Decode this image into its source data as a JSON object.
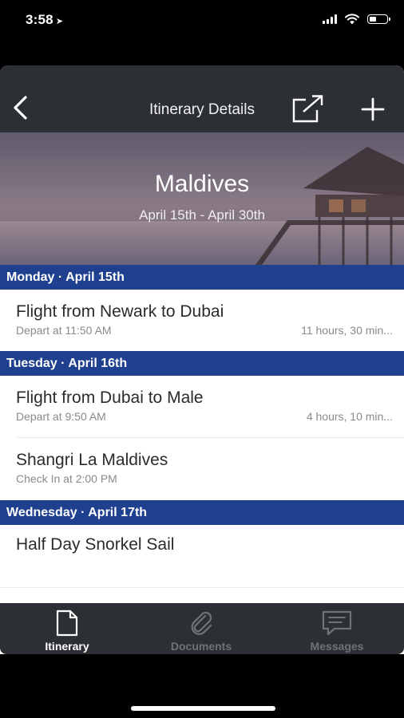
{
  "status": {
    "time": "3:58",
    "location_icon": "location-arrow-icon",
    "signal_icon": "signal-icon",
    "wifi_icon": "wifi-icon",
    "battery_icon": "battery-icon"
  },
  "nav": {
    "title": "Itinerary Details",
    "back_icon": "chevron-left-icon",
    "share_icon": "share-icon",
    "add_icon": "plus-icon"
  },
  "hero": {
    "title": "Maldives",
    "dates": "April 15th - April 30th"
  },
  "days": [
    {
      "header": "Monday · April 15th",
      "items": [
        {
          "title": "Flight from Newark to Dubai",
          "subtitle": "Depart at 11:50 AM",
          "duration": "11 hours, 30 min..."
        }
      ]
    },
    {
      "header": "Tuesday · April 16th",
      "items": [
        {
          "title": "Flight from Dubai to Male",
          "subtitle": "Depart at 9:50 AM",
          "duration": "4 hours, 10 min..."
        },
        {
          "title": "Shangri La Maldives",
          "subtitle": "Check In at 2:00 PM",
          "duration": ""
        }
      ]
    },
    {
      "header": "Wednesday · April 17th",
      "items": [
        {
          "title": "Half Day Snorkel Sail",
          "subtitle": "",
          "duration": ""
        }
      ]
    }
  ],
  "tabs": [
    {
      "label": "Itinerary",
      "icon": "document-icon",
      "active": true
    },
    {
      "label": "Documents",
      "icon": "paperclip-icon",
      "active": false
    },
    {
      "label": "Messages",
      "icon": "message-icon",
      "active": false
    }
  ],
  "colors": {
    "nav_bg": "#2c2f33",
    "day_header": "#1f3f8f",
    "tab_active": "#ffffff",
    "tab_inactive": "#6f7378"
  }
}
